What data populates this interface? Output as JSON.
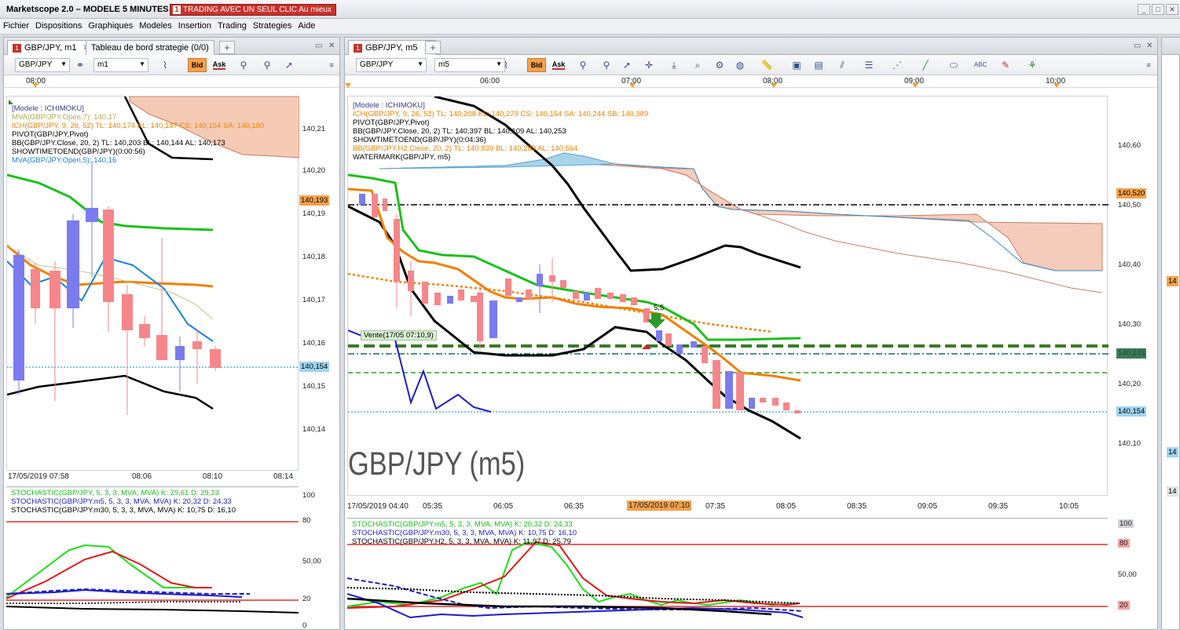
{
  "app": {
    "title": "Marketscope 2.0 – MODELE 5 MINUTES",
    "promo_badge": "1",
    "promo": "TRADING AVEC UN SEUL CLIC Au mieux"
  },
  "window_controls": {
    "minimize": "_",
    "restore": "□",
    "close": "✕"
  },
  "menu": [
    "Fichier",
    "Dispositions",
    "Graphiques",
    "Modeles",
    "Insertion",
    "Trading",
    "Strategies",
    "Aide"
  ],
  "left": {
    "tabs": [
      {
        "badge": "1",
        "label": "GBP/JPY, m1"
      },
      {
        "label": "Tableau de bord strategie (0/0)"
      }
    ],
    "instrument": "GBP/JPY",
    "timeframe": "m1",
    "bid": "Bid",
    "ask": "Ask",
    "top_time": "08:00",
    "indicators": [
      {
        "text": "[Modele : ICHIMOKU]",
        "color": "#3b3b8f"
      },
      {
        "text": "MVA(GBP/JPY.Open,7): 140,17",
        "color": "#b3a94a"
      },
      {
        "text": "ICH(GBP/JPY, 9, 26, 52)  TL: 140,174  KL: 140,187  CS: 140,154  SA: 140,180",
        "color": "#f08000"
      },
      {
        "text": "PIVOT(GBP/JPY,Pivot)",
        "color": "#000000"
      },
      {
        "text": "BB(GBP/JPY.Close, 20, 2)  TL: 140,203  BL: 140,144  AL: 140,173",
        "color": "#000000"
      },
      {
        "text": "SHOWTIMETOEND(GBP/JPY)(0:00:56)",
        "color": "#000000"
      },
      {
        "text": "MVA(GBP/JPY.Open,5): 140,16",
        "color": "#1a7fe0"
      }
    ],
    "price_ticks": [
      "140,21",
      "140,20",
      "140,19",
      "140,18",
      "140,17",
      "140,16",
      "140,15",
      "140,14"
    ],
    "price_tag_ask": "140,193",
    "price_tag_bid": "140,154",
    "bottom_times": [
      "17/05/2019 07:58",
      "08:06",
      "08:10",
      "08:14"
    ],
    "osc": [
      {
        "text": "STOCHASTIC(GBP/JPY, 5, 3, 3, MVA, MVA)  K: 29,61  D: 29,23",
        "color": "#19c019"
      },
      {
        "text": "STOCHASTIC(GBP/JPY.m5, 5, 3, 3, MVA, MVA)  K: 20,32  D: 24,33",
        "color": "#1c1cc8"
      },
      {
        "text": "STOCHASTIC(GBP/JPY.m30, 5, 3, 3, MVA, MVA)  K: 10,75  D: 16,10",
        "color": "#000000"
      }
    ],
    "osc_ticks": [
      "100",
      "80",
      "50,00",
      "20",
      "0"
    ]
  },
  "right": {
    "tabs": [
      {
        "badge": "1",
        "label": "GBP/JPY, m5"
      }
    ],
    "instrument": "GBP/JPY",
    "timeframe": "m5",
    "bid": "Bid",
    "ask": "Ask",
    "top_times": [
      "06:00",
      "07:00",
      "08:00",
      "09:00",
      "10:00"
    ],
    "indicators": [
      {
        "text": "[Modele : ICHIMOKU]",
        "color": "#3b3b8f"
      },
      {
        "text": "ICH(GBP/JPY, 9, 26, 52)  TL: 140,208  KL: 140,279  CS: 140,154  SA: 140,244  SB: 140,389",
        "color": "#f08000"
      },
      {
        "text": "PIVOT(GBP/JPY,Pivot)",
        "color": "#000000"
      },
      {
        "text": "BB(GBP/JPY.Close, 20, 2)  TL: 140,397  BL: 140,109  AL: 140,253",
        "color": "#000000"
      },
      {
        "text": "SHOWTIMETOEND(GBP/JPY)(0:04:36)",
        "color": "#000000"
      },
      {
        "text": "BB(GBP/JPY.H2.Close, 20, 2)  TL: 140,839  BL: 140,289  AL: 140,564",
        "color": "#f08000"
      },
      {
        "text": "WATERMARK(GBP/JPY, m5)",
        "color": "#000000"
      }
    ],
    "watermark": "GBP/JPY (m5)",
    "trade_label": "Vente(17/05 07:10,9)",
    "trade_price": "5,5",
    "price_ticks": [
      "140,60",
      "140,50",
      "140,40",
      "140,30",
      "140,20",
      "140,10"
    ],
    "price_tag_ask": "140,520",
    "price_tag_mid": "140,243",
    "price_tag_bid": "140,154",
    "bottom_times": [
      "17/05/2019 04:40",
      "05:35",
      "06:05",
      "06:35",
      "17/05/2019 07:10",
      "07:35",
      "08:05",
      "08:35",
      "09:05",
      "09:35",
      "10:05"
    ],
    "osc": [
      {
        "text": "STOCHASTIC(GBP/JPY.m5, 5, 3, 3, MVA, MVA)  K: 20,32  D: 24,33",
        "color": "#19c019"
      },
      {
        "text": "STOCHASTIC(GBP/JPY.m30, 5, 3, 3, MVA, MVA)  K: 10,75  D: 16,10",
        "color": "#1c1cc8"
      },
      {
        "text": "STOCHASTIC(GBP/JPY.H2, 5, 3, 3, MVA, MVA)  K: 11,97  D: 25,79",
        "color": "#000000"
      }
    ],
    "osc_ticks": [
      "100",
      "80",
      "50,00",
      "20"
    ]
  },
  "side_tags": [
    "14",
    "14",
    "14"
  ]
}
